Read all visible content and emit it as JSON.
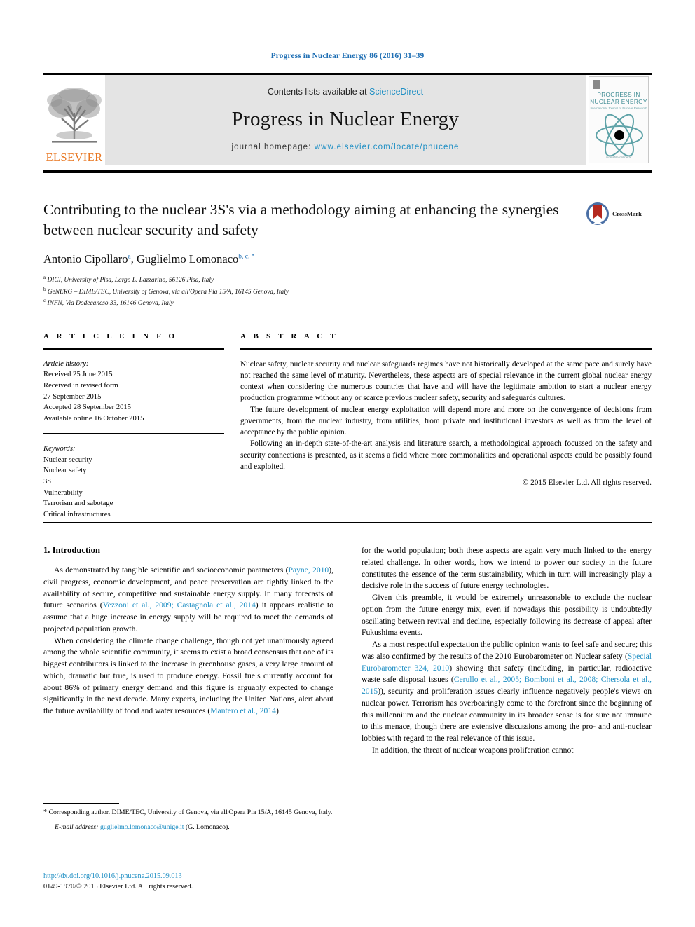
{
  "running_head": "Progress in Nuclear Energy 86 (2016) 31–39",
  "journal_header": {
    "contents_prefix": "Contents lists available at ",
    "sciencedirect": "ScienceDirect",
    "journal_title": "Progress in Nuclear Energy",
    "homepage_label": "journal homepage: ",
    "homepage_url": "www.elsevier.com/locate/pnucene",
    "publisher_wordmark": "ELSEVIER",
    "publisher_logo_icon": "elsevier-tree-icon",
    "cover": {
      "line1": "PROGRESS IN",
      "line2": "NUCLEAR ENERGY",
      "subtitle": "International Journal of Nuclear Research",
      "footer": "available online at",
      "atom_icon": "atom-orbital-icon"
    },
    "colors": {
      "link": "#1f8fc4",
      "band": "#e4e4e4",
      "elsevier_orange": "#e87722",
      "cover_teal": "#3f8c94"
    }
  },
  "article": {
    "title": "Contributing to the nuclear 3S's via a methodology aiming at enhancing the synergies between nuclear security and safety",
    "authors": [
      {
        "name": "Antonio Cipollaro",
        "marks": "a"
      },
      {
        "name": "Guglielmo Lomonaco",
        "marks": "b, c, *"
      }
    ],
    "authors_separator": ", ",
    "affiliations": [
      {
        "mark": "a",
        "text": "DICI, University of Pisa, Largo L. Lazzarino, 56126 Pisa, Italy"
      },
      {
        "mark": "b",
        "text": "GeNERG – DIME/TEC, University of Genova, via all'Opera Pia 15/A, 16145 Genova, Italy"
      },
      {
        "mark": "c",
        "text": "INFN, Via Dodecaneso 33, 16146 Genova, Italy"
      }
    ],
    "crossmark_label": "CrossMark",
    "crossmark_icon": "crossmark-icon"
  },
  "article_info": {
    "heading": "A R T I C L E  I N F O",
    "history_label": "Article history:",
    "history": [
      "Received 25 June 2015",
      "Received in revised form",
      "27 September 2015",
      "Accepted 28 September 2015",
      "Available online 16 October 2015"
    ],
    "keywords_label": "Keywords:",
    "keywords": [
      "Nuclear security",
      "Nuclear safety",
      "3S",
      "Vulnerability",
      "Terrorism and sabotage",
      "Critical infrastructures"
    ]
  },
  "abstract": {
    "heading": "A B S T R A C T",
    "paragraphs": [
      "Nuclear safety, nuclear security and nuclear safeguards regimes have not historically developed at the same pace and surely have not reached the same level of maturity. Nevertheless, these aspects are of special relevance in the current global nuclear energy context when considering the numerous countries that have and will have the legitimate ambition to start a nuclear energy production programme without any or scarce previous nuclear safety, security and safeguards cultures.",
      "The future development of nuclear energy exploitation will depend more and more on the convergence of decisions from governments, from the nuclear industry, from utilities, from private and institutional investors as well as from the level of acceptance by the public opinion.",
      "Following an in-depth state-of-the-art analysis and literature search, a methodological approach focussed on the safety and security connections is presented, as it seems a field where more commonalities and operational aspects could be possibly found and exploited."
    ],
    "copyright": "© 2015 Elsevier Ltd. All rights reserved."
  },
  "body": {
    "section_number_title": "1. Introduction",
    "left_paragraphs": [
      {
        "segments": [
          {
            "text": "As demonstrated by tangible scientific and socioeconomic parameters (",
            "cite": false
          },
          {
            "text": "Payne, 2010",
            "cite": true
          },
          {
            "text": "), civil progress, economic development, and peace preservation are tightly linked to the availability of secure, competitive and sustainable energy supply. In many forecasts of future scenarios (",
            "cite": false
          },
          {
            "text": "Vezzoni et al., 2009; Castagnola et al., 2014",
            "cite": true
          },
          {
            "text": ") it appears realistic to assume that a huge increase in energy supply will be required to meet the demands of projected population growth.",
            "cite": false
          }
        ]
      },
      {
        "segments": [
          {
            "text": "When considering the climate change challenge, though not yet unanimously agreed among the whole scientific community, it seems to exist a broad consensus that one of its biggest contributors is linked to the increase in greenhouse gases, a very large amount of which, dramatic but true, is used to produce energy. Fossil fuels currently account for about 86% of primary energy demand and this figure is arguably expected to change significantly in the next decade. Many experts, including the United Nations, alert about the future availability of food and water resources (",
            "cite": false
          },
          {
            "text": "Mantero et al., 2014",
            "cite": true
          },
          {
            "text": ")",
            "cite": false
          }
        ]
      }
    ],
    "right_paragraphs": [
      {
        "segments": [
          {
            "text": "for the world population; both these aspects are again very much linked to the energy related challenge. In other words, how we intend to power our society in the future constitutes the essence of the term sustainability, which in turn will increasingly play a decisive role in the success of future energy technologies.",
            "cite": false
          }
        ],
        "no_indent": true
      },
      {
        "segments": [
          {
            "text": "Given this preamble, it would be extremely unreasonable to exclude the nuclear option from the future energy mix, even if nowadays this possibility is undoubtedly oscillating between revival and decline, especially following its decrease of appeal after Fukushima events.",
            "cite": false
          }
        ]
      },
      {
        "segments": [
          {
            "text": "As a most respectful expectation the public opinion wants to feel safe and secure; this was also confirmed by the results of the 2010 Eurobarometer on Nuclear safety (",
            "cite": false
          },
          {
            "text": "Special Eurobarometer 324, 2010",
            "cite": true
          },
          {
            "text": ") showing that safety (including, in particular, radioactive waste safe disposal issues (",
            "cite": false
          },
          {
            "text": "Cerullo et al., 2005; Bomboni et al., 2008; Chersola et al., 2015",
            "cite": true
          },
          {
            "text": ")), security and proliferation issues clearly influence negatively people's views on nuclear power. Terrorism has overbearingly come to the forefront since the beginning of this millennium and the nuclear community in its broader sense is for sure not immune to this menace, though there are extensive discussions among the pro- and anti-nuclear lobbies with regard to the real relevance of this issue.",
            "cite": false
          }
        ]
      },
      {
        "segments": [
          {
            "text": "In addition, the threat of nuclear weapons proliferation cannot",
            "cite": false
          }
        ]
      }
    ]
  },
  "footnote": {
    "star": "*",
    "text": " Corresponding author. DIME/TEC, University of Genova, via all'Opera Pia 15/A, 16145 Genova, Italy.",
    "email_label": "E-mail address:",
    "email": "guglielmo.lomonaco@unige.it",
    "email_suffix": " (G. Lomonaco)."
  },
  "footer": {
    "doi": "http://dx.doi.org/10.1016/j.pnucene.2015.09.013",
    "issn_line": "0149-1970/© 2015 Elsevier Ltd. All rights reserved."
  }
}
